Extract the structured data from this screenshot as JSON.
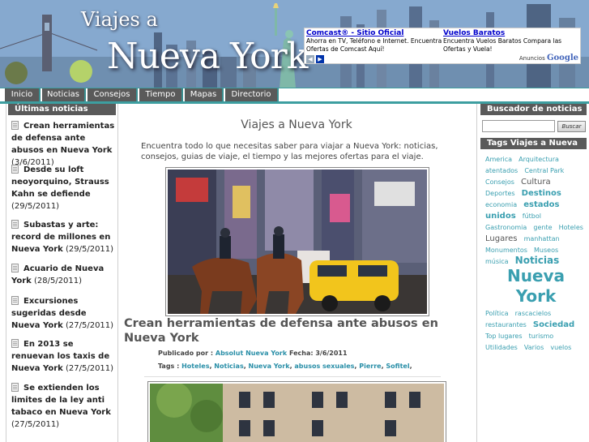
{
  "header": {
    "title_line1": "Viajes a",
    "title_line2": "Nueva York"
  },
  "ad": {
    "ads": [
      {
        "title": "Comcast® - Sitio Oficial",
        "text": "Ahorra en TV, Teléfono e Internet. Encuentra Ofertas de Comcast Aquí!"
      },
      {
        "title": "Vuelos Baratos",
        "text": "Encuentra Vuelos Baratos Compara las Ofertas y Vuela!"
      }
    ],
    "prev_icon": "◀",
    "next_icon": "▶",
    "attribution": "Anuncios",
    "attribution_brand": "Google"
  },
  "nav": {
    "items": [
      {
        "label": "Inicio"
      },
      {
        "label": "Noticias"
      },
      {
        "label": "Consejos"
      },
      {
        "label": "Tiempo"
      },
      {
        "label": "Mapas"
      },
      {
        "label": "Directorio"
      }
    ]
  },
  "left_sidebar": {
    "title": "Últimas noticias",
    "items": [
      {
        "title": "Crean herramientas de defensa ante abusos en Nueva York",
        "date": "(3/6/2011)"
      },
      {
        "title": "Desde su loft neoyorquino, Strauss Kahn se defiende",
        "date": "(29/5/2011)"
      },
      {
        "title": "Subastas y arte: record de millones en Nueva York",
        "date": "(29/5/2011)"
      },
      {
        "title": "Acuario de Nueva York",
        "date": "(28/5/2011)"
      },
      {
        "title": "Excursiones sugeridas desde Nueva York",
        "date": "(27/5/2011)"
      },
      {
        "title": "En 2013 se renuevan los taxis de Nueva York",
        "date": "(27/5/2011)"
      },
      {
        "title": "Se extienden los limites de la ley anti tabaco en Nueva York",
        "date": "(27/5/2011)"
      }
    ]
  },
  "main": {
    "page_title": "Viajes a Nueva York",
    "intro": "Encuentra todo lo que necesitas saber para viajar a Nueva York: noticias, consejos, guias de viaje, el tiempo y las mejores ofertas para el viaje.",
    "article": {
      "title": "Crean herramientas de defensa ante abusos en Nueva York",
      "published_label": "Publicado por :",
      "author": "Absolut Nueva York",
      "date_label": "Fecha: 3/6/2011",
      "tags_label": "Tags :",
      "tags": [
        "Hoteles",
        "Noticias",
        "Nueva York",
        "abusos sexuales",
        "Pierre",
        "Sofitel"
      ]
    }
  },
  "right_sidebar": {
    "search_title": "Buscador de noticias",
    "search_button": "Buscar",
    "tags_title": "Tags Viajes a Nueva",
    "tags": [
      {
        "label": "America",
        "size": 8
      },
      {
        "label": "Arquitectura",
        "size": 8
      },
      {
        "label": "atentados",
        "size": 8
      },
      {
        "label": "Central Park",
        "size": 8
      },
      {
        "label": "Consejos",
        "size": 8
      },
      {
        "label": "Cultura",
        "size": 10
      },
      {
        "label": "Deportes",
        "size": 8
      },
      {
        "label": "Destinos",
        "size": 10
      },
      {
        "label": "economia",
        "size": 8
      },
      {
        "label": "estados unidos",
        "size": 10
      },
      {
        "label": "fútbol",
        "size": 8
      },
      {
        "label": "Gastronomia",
        "size": 8
      },
      {
        "label": "gente",
        "size": 8
      },
      {
        "label": "Hoteles",
        "size": 8
      },
      {
        "label": "Lugares",
        "size": 10
      },
      {
        "label": "manhattan",
        "size": 8
      },
      {
        "label": "Monumentos",
        "size": 8
      },
      {
        "label": "Museos",
        "size": 8
      },
      {
        "label": "música",
        "size": 8
      },
      {
        "label": "Noticias",
        "size": 12
      },
      {
        "label": "Nueva York",
        "size": 20
      },
      {
        "label": "Política",
        "size": 8
      },
      {
        "label": "rascacielos",
        "size": 8
      },
      {
        "label": "restaurantes",
        "size": 8
      },
      {
        "label": "Sociedad",
        "size": 10
      },
      {
        "label": "Top lugares",
        "size": 8
      },
      {
        "label": "turismo",
        "size": 8
      },
      {
        "label": "Utilidades",
        "size": 8
      },
      {
        "label": "Varios",
        "size": 8
      },
      {
        "label": "vuelos",
        "size": 8
      }
    ]
  },
  "colors": {
    "accent": "#3d9ea0",
    "nav_bg": "#5a5a5a",
    "link": "#2a8fa8",
    "tag": "#3a9fb0"
  }
}
